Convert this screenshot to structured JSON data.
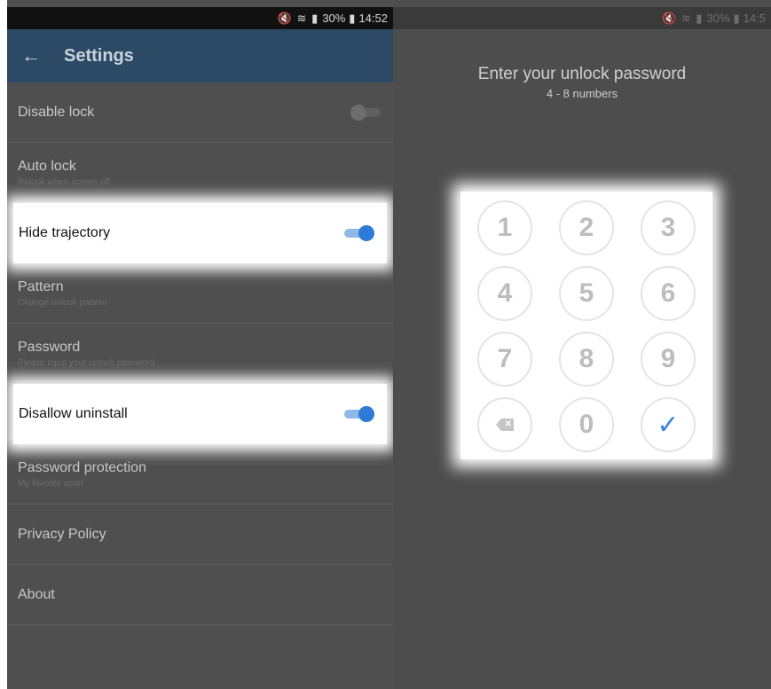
{
  "left": {
    "status": {
      "icons": "🔇 ≋ ▮",
      "battery": "30%",
      "time": "14:52"
    },
    "appbar": {
      "back": "←",
      "title": "Settings"
    },
    "settings": [
      {
        "title": "Disable lock",
        "subtitle": "",
        "toggle": "off"
      },
      {
        "title": "Auto lock",
        "subtitle": "Relock when screen off"
      },
      {
        "title": "Hide trajectory",
        "subtitle": "",
        "toggle": "on",
        "highlighted": true
      },
      {
        "title": "Pattern",
        "subtitle": "Change unlock pattern"
      },
      {
        "title": "Password",
        "subtitle": "Please input your unlock password"
      },
      {
        "title": "Disallow uninstall",
        "subtitle": "",
        "toggle": "on",
        "highlighted": true
      },
      {
        "title": "Password protection",
        "subtitle": "My favorite sport"
      },
      {
        "title": "Privacy Policy",
        "subtitle": ""
      },
      {
        "title": "About",
        "subtitle": ""
      }
    ]
  },
  "right": {
    "status": {
      "icons": "🔇 ≋ ▮",
      "battery": "30%",
      "time": "14:5"
    },
    "title": "Enter your unlock password",
    "subtitle": "4 - 8 numbers",
    "keys": [
      "1",
      "2",
      "3",
      "4",
      "5",
      "6",
      "7",
      "8",
      "9",
      "⌫",
      "0",
      "✓"
    ]
  },
  "colors": {
    "toggle_on": "#2d7bd6",
    "appbar": "#2c4a66",
    "check": "#3d86d8"
  }
}
